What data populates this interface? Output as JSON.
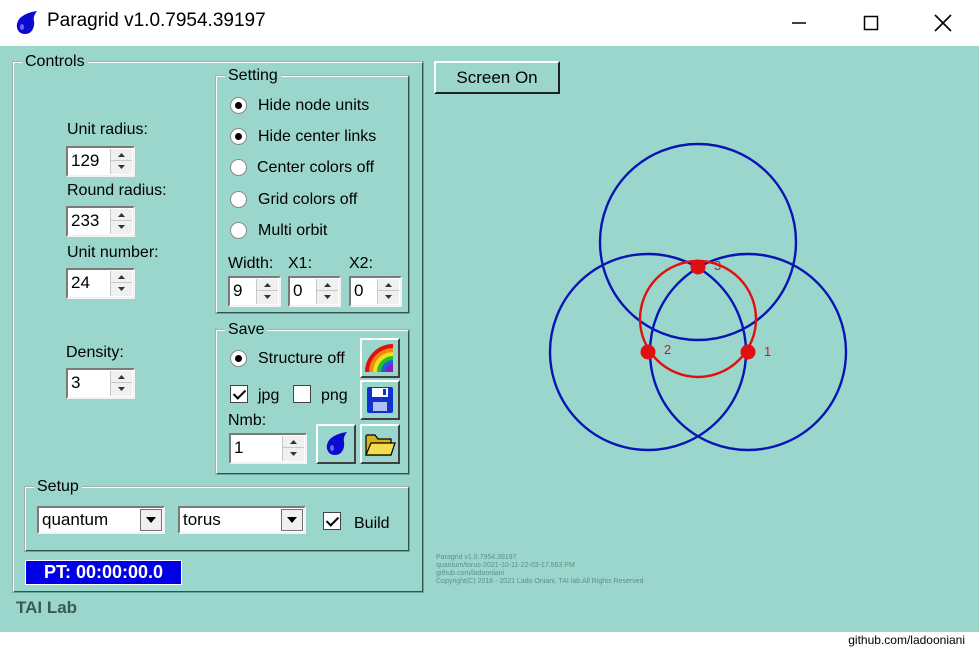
{
  "window": {
    "title": "Paragrid v1.0.7954.39197",
    "minimize": "—",
    "maximize": "☐",
    "close": "✕"
  },
  "controls": {
    "legend": "Controls",
    "unit_radius": {
      "label": "Unit radius:",
      "value": "129"
    },
    "round_radius": {
      "label": "Round radius:",
      "value": "233"
    },
    "unit_number": {
      "label": "Unit number:",
      "value": "24"
    },
    "density": {
      "label": "Density:",
      "value": "3"
    }
  },
  "setting": {
    "legend": "Setting",
    "options": [
      {
        "label": "Hide node units",
        "checked": true
      },
      {
        "label": "Hide center links",
        "checked": true
      },
      {
        "label": "Center colors off",
        "checked": false
      },
      {
        "label": "Grid colors off",
        "checked": false
      },
      {
        "label": "Multi orbit",
        "checked": false
      }
    ],
    "width": {
      "label": "Width:",
      "value": "9"
    },
    "x1": {
      "label": "X1:",
      "value": "0"
    },
    "x2": {
      "label": "X2:",
      "value": "0"
    }
  },
  "save": {
    "legend": "Save",
    "structure_off": {
      "label": "Structure off",
      "checked": true
    },
    "jpg": {
      "label": "jpg",
      "checked": true
    },
    "png": {
      "label": "png",
      "checked": false
    },
    "nmb": {
      "label": "Nmb:",
      "value": "1"
    }
  },
  "setup": {
    "legend": "Setup",
    "mode": "quantum",
    "shape": "torus",
    "build": {
      "label": "Build",
      "checked": true
    }
  },
  "pt_label": "PT: 00:00:00.0",
  "lab_label": "TAI Lab",
  "screen_button": "Screen On",
  "info_lines": [
    "Paragrid v1.0.7954.39197",
    "quantum/torus-2021-10-11-22-03-17.563 PM",
    "github.com/ladooniani",
    "Copyright(C) 2016 - 2021 Lado Oniani, TAI lab.All Rights Reserved"
  ],
  "diagram": {
    "blue_color": "#0a14b4",
    "red_color": "#e01010",
    "node_labels": [
      "1",
      "2",
      "3"
    ]
  },
  "footer_text": "github.com/ladooniani"
}
